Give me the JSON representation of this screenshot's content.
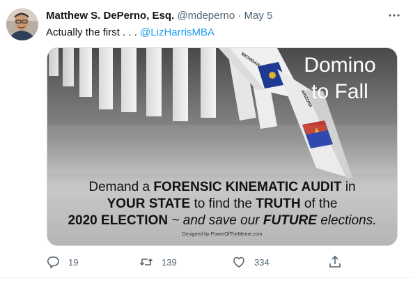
{
  "tweet": {
    "author_name": "Matthew S. DePerno, Esq.",
    "handle": "@mdeperno",
    "separator": "·",
    "date": "May 5",
    "text_prefix": "Actually the first . . . ",
    "mention": "@LizHarrisMBA"
  },
  "media": {
    "title_line1": "Domino",
    "title_line2": "to Fall",
    "domino_label_1": "MICHIGAN",
    "domino_label_2": "ARIZONA",
    "line1_a": "Demand a ",
    "line1_b": "FORENSIC KINEMATIC AUDIT",
    "line1_c": " in",
    "line2_a": "YOUR STATE",
    "line2_b": " to find the ",
    "line2_c": "TRUTH",
    "line2_d": " of the",
    "line3_a": "2020 ELECTION",
    "line3_b": " ~ and save our ",
    "line3_c": "FUTURE",
    "line3_d": " elections.",
    "credit": "Designed by PowerOfTheMeme.com"
  },
  "actions": {
    "reply_count": "19",
    "retweet_count": "139",
    "like_count": "334"
  },
  "colors": {
    "accent": "#1d9bf0",
    "secondary_text": "#536471",
    "michigan_flag": "#1f3a93",
    "arizona_flag_star": "#e0b030",
    "arizona_flag_field": "#1f3aa8",
    "arizona_flag_rays": "#c0392b"
  },
  "icons": [
    "avatar-photo",
    "more-icon",
    "reply-icon",
    "retweet-icon",
    "like-icon",
    "share-icon"
  ]
}
